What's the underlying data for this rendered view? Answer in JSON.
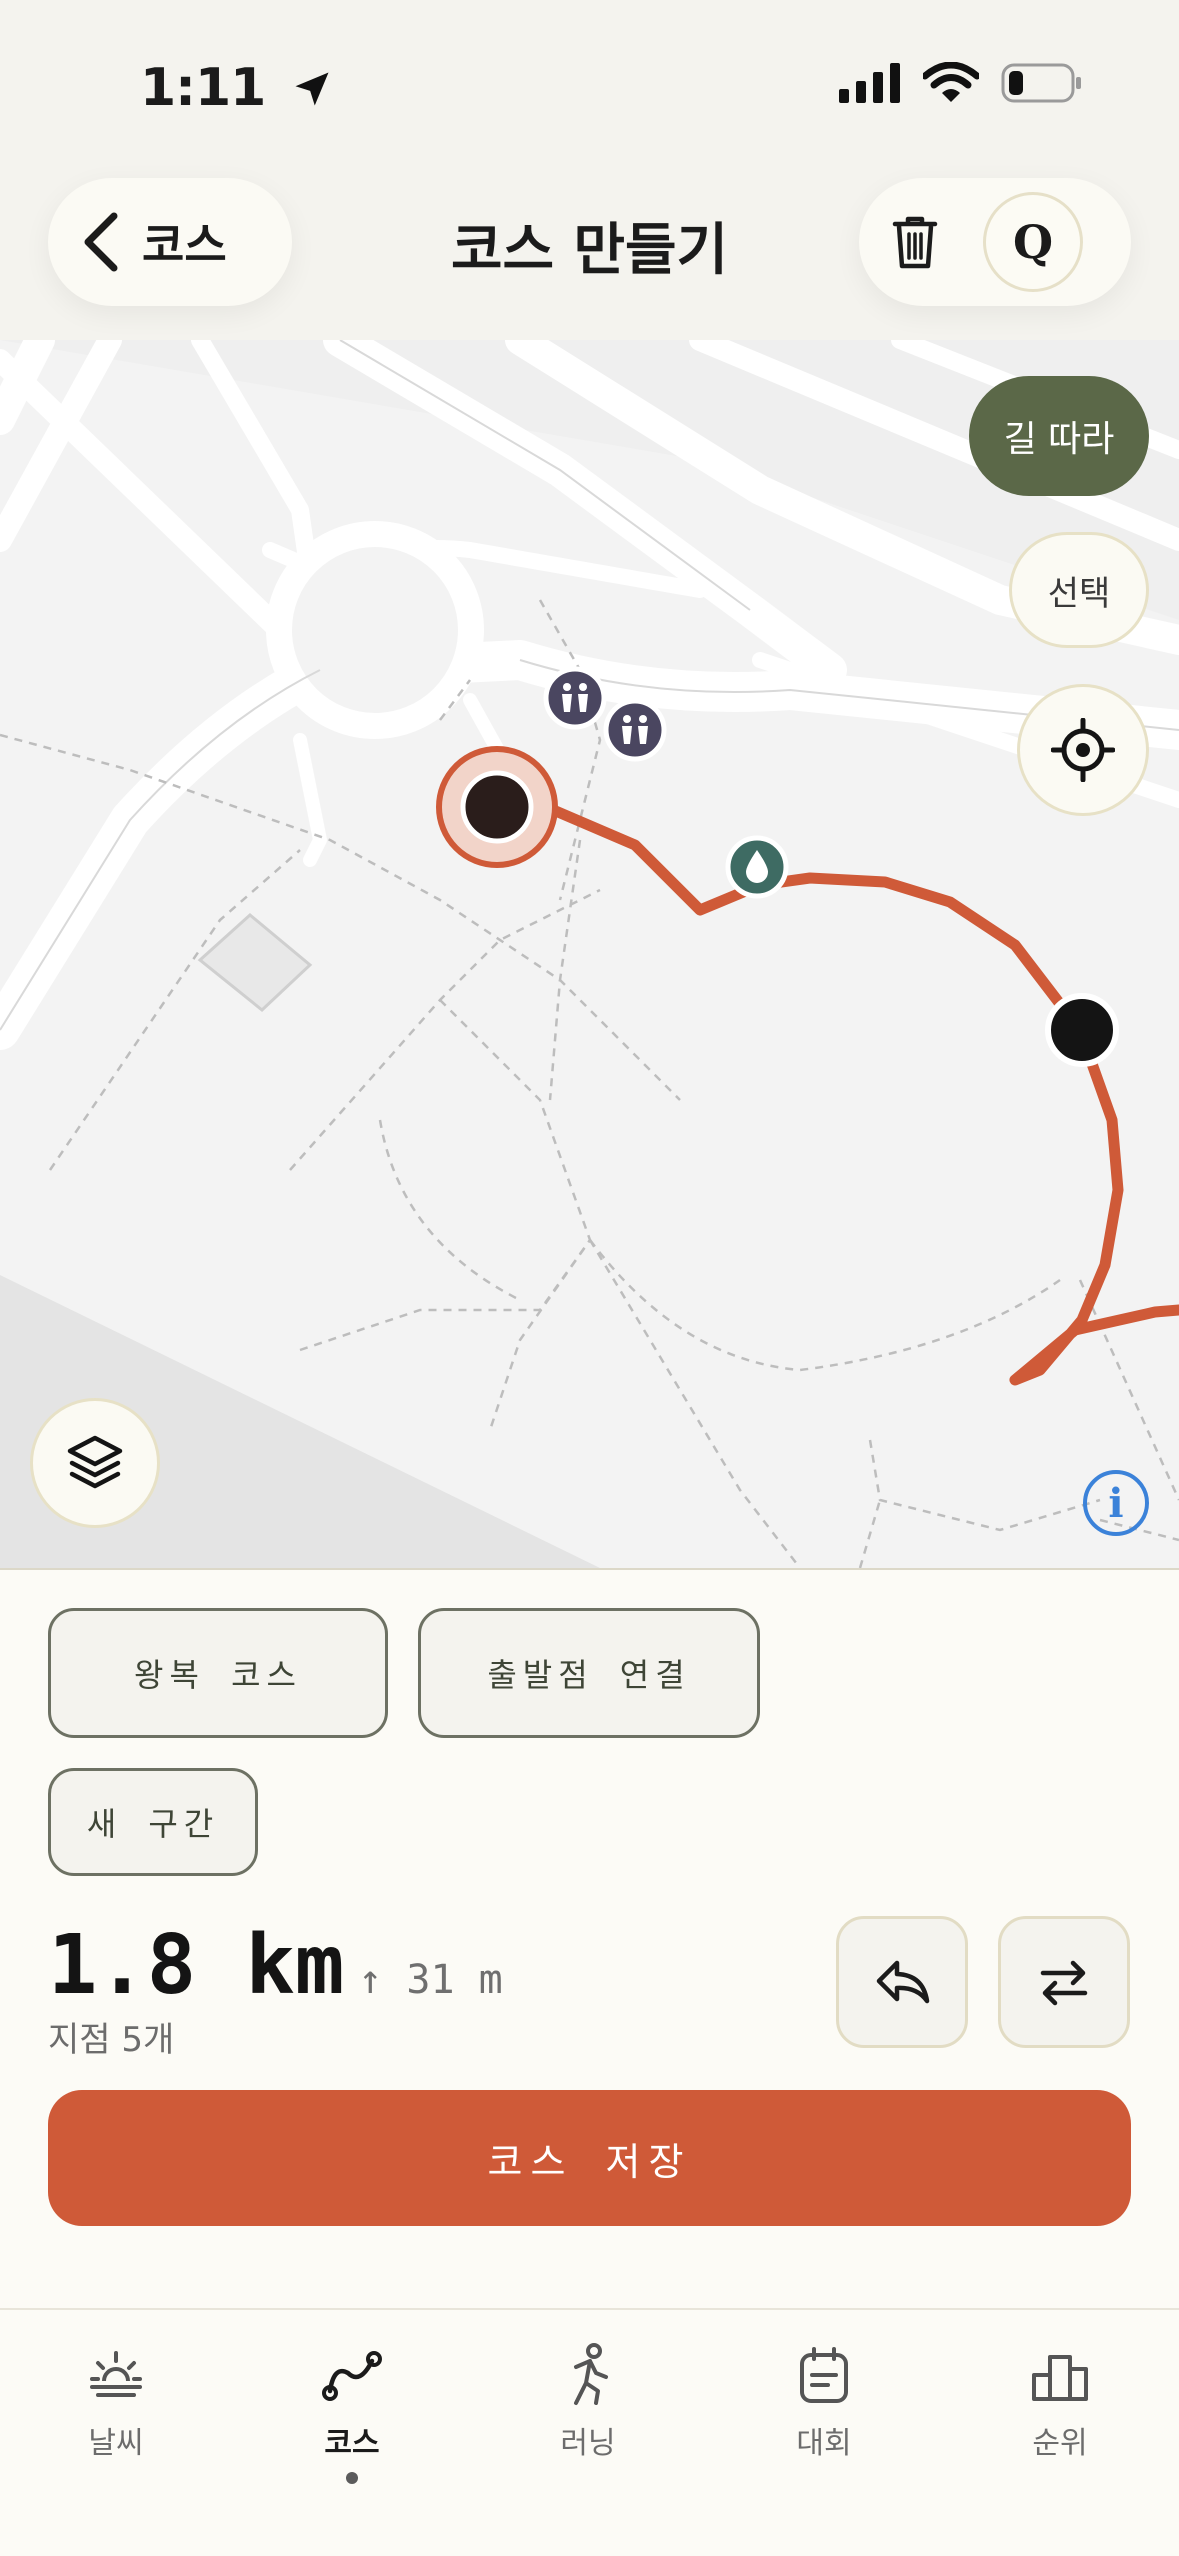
{
  "status": {
    "time": "1:11"
  },
  "header": {
    "back_label": "코스",
    "title": "코스 만들기",
    "q_label": "Q"
  },
  "map": {
    "follow_road_label": "길 따라",
    "select_label": "선택",
    "info_label": "i"
  },
  "sheet": {
    "chips": [
      "왕복 코스",
      "출발점 연결",
      "새 구간"
    ],
    "distance": "1.8 km",
    "elevation": "↑ 31 m",
    "points": "지점 5개",
    "save_label": "코스 저장"
  },
  "tabs": [
    {
      "label": "날씨",
      "icon": "sunrise-icon",
      "active": false
    },
    {
      "label": "코스",
      "icon": "route-icon",
      "active": true
    },
    {
      "label": "러닝",
      "icon": "runner-icon",
      "active": false
    },
    {
      "label": "대회",
      "icon": "calendar-icon",
      "active": false
    },
    {
      "label": "순위",
      "icon": "podium-icon",
      "active": false
    }
  ],
  "colors": {
    "route": "#cf5a38",
    "follow_button": "#5b6848",
    "save_button": "#cf5a38",
    "background": "#fcfbf6"
  }
}
